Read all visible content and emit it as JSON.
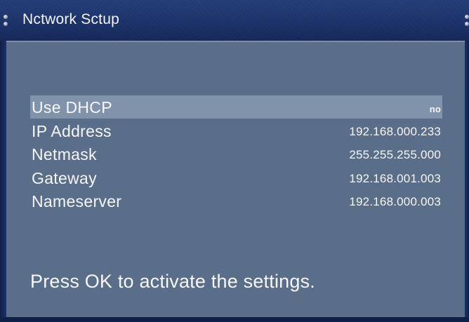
{
  "window": {
    "title": "Nctwork Sctup"
  },
  "settings": [
    {
      "label": "Use DHCP",
      "value": "no",
      "selected": true
    },
    {
      "label": "IP Address",
      "value": "192.168.000.233",
      "selected": false
    },
    {
      "label": "Netmask",
      "value": "255.255.255.000",
      "selected": false
    },
    {
      "label": "Gateway",
      "value": "192.168.001.003",
      "selected": false
    },
    {
      "label": "Nameserver",
      "value": "192.168.000.003",
      "selected": false
    }
  ],
  "hint": "Press OK to activate the settings.",
  "colors": {
    "title_bar": "#1a3168",
    "panel": "#5a6e8a",
    "selected_row": "#8193ab",
    "text": "#f5f7fb"
  }
}
